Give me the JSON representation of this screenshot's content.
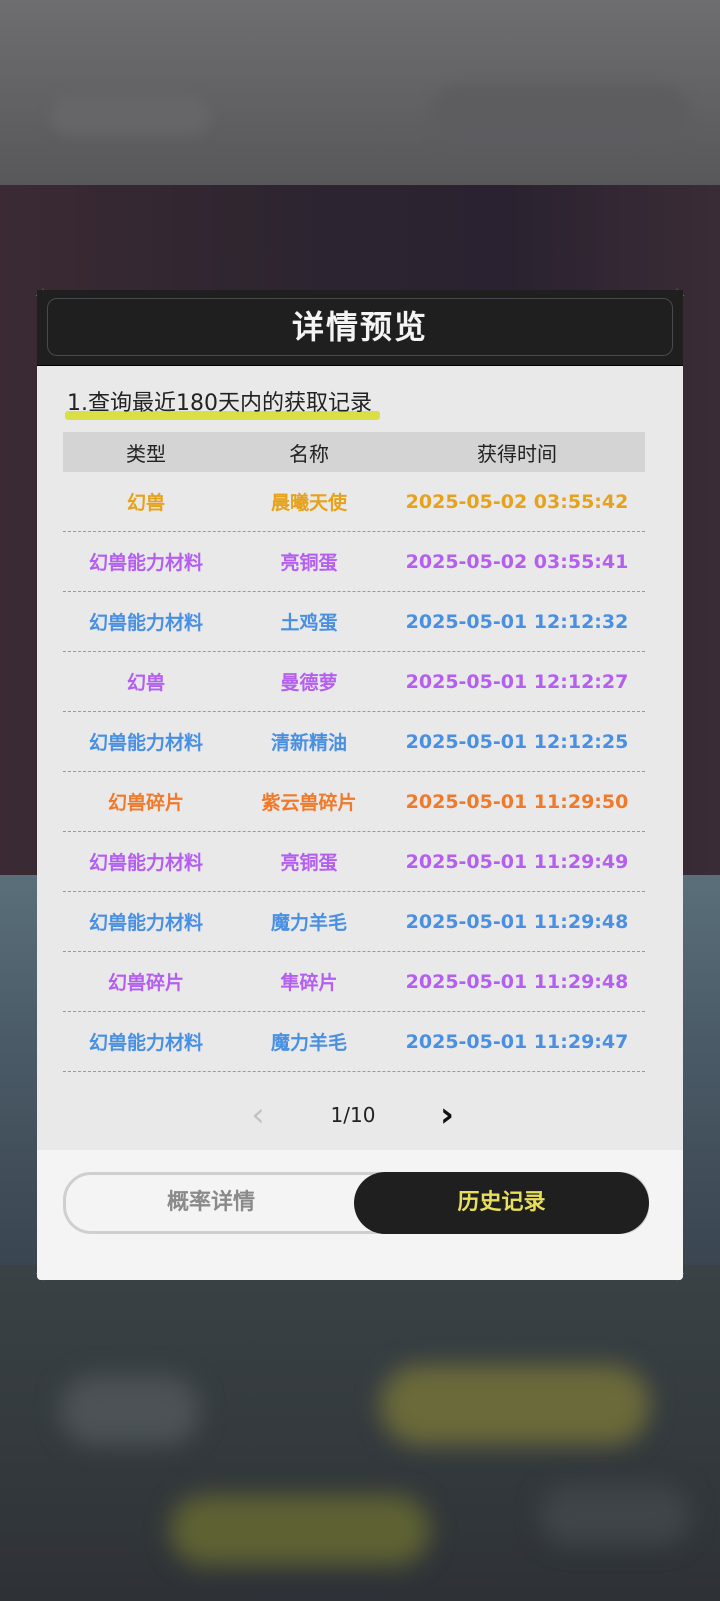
{
  "dialog": {
    "title": "详情预览",
    "query_note": "1.查询最近180天内的获取记录"
  },
  "table": {
    "headers": [
      "类型",
      "名称",
      "获得时间"
    ],
    "rows": [
      {
        "type": "幻兽",
        "name": "晨曦天使",
        "time": "2025-05-02 03:55:42",
        "color": "#e6a21c"
      },
      {
        "type": "幻兽能力材料",
        "name": "亮铜蛋",
        "time": "2025-05-02 03:55:41",
        "color": "#b45ff0"
      },
      {
        "type": "幻兽能力材料",
        "name": "土鸡蛋",
        "time": "2025-05-01 12:12:32",
        "color": "#4a90e2"
      },
      {
        "type": "幻兽",
        "name": "曼德萝",
        "time": "2025-05-01 12:12:27",
        "color": "#b45ff0"
      },
      {
        "type": "幻兽能力材料",
        "name": "清新精油",
        "time": "2025-05-01 12:12:25",
        "color": "#4a90e2"
      },
      {
        "type": "幻兽碎片",
        "name": "紫云兽碎片",
        "time": "2025-05-01 11:29:50",
        "color": "#f07a2a"
      },
      {
        "type": "幻兽能力材料",
        "name": "亮铜蛋",
        "time": "2025-05-01 11:29:49",
        "color": "#b45ff0"
      },
      {
        "type": "幻兽能力材料",
        "name": "魔力羊毛",
        "time": "2025-05-01 11:29:48",
        "color": "#4a90e2"
      },
      {
        "type": "幻兽碎片",
        "name": "隼碎片",
        "time": "2025-05-01 11:29:48",
        "color": "#b45ff0"
      },
      {
        "type": "幻兽能力材料",
        "name": "魔力羊毛",
        "time": "2025-05-01 11:29:47",
        "color": "#4a90e2"
      }
    ]
  },
  "pager": {
    "page_text": "1/10"
  },
  "tabs": {
    "left_label": "概率详情",
    "right_label": "历史记录"
  },
  "colors": {
    "header_bg": "#1f1f20",
    "accent_yellow": "#d9df45",
    "legendary_orange": "#e6a21c",
    "epic_purple": "#b45ff0",
    "rare_blue": "#4a90e2",
    "shard_orange": "#f07a2a"
  },
  "icons": {
    "prev": "chevron-left-icon",
    "next": "chevron-right-icon",
    "corner": "corner-ornament-icon"
  }
}
